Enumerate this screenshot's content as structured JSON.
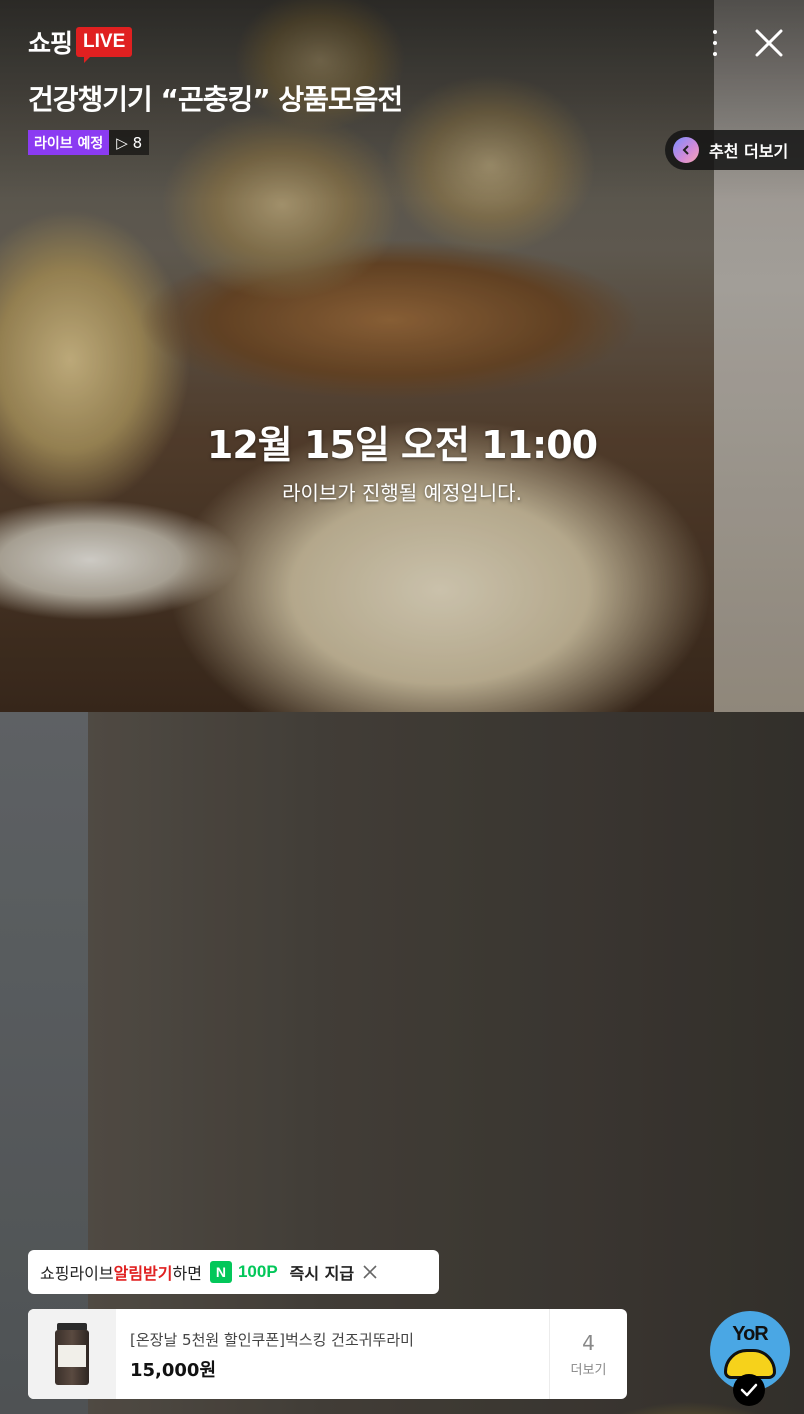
{
  "header": {
    "logo_text": "쇼핑",
    "logo_badge": "LIVE",
    "title": "건강챙기기 “곤충킹” 상품모음전",
    "status_badge": "라이브 예정",
    "view_count": "▷ 8"
  },
  "recommend": {
    "label": "추천 더보기"
  },
  "schedule": {
    "datetime": "12월 15일 오전 11:00",
    "message": "라이브가 진행될 예정입니다."
  },
  "notify": {
    "text_prefix": "쇼핑라이브 ",
    "text_highlight": "알림받기",
    "text_suffix": "하면",
    "pay_icon": "N",
    "points": "100P",
    "reward": "즉시 지급"
  },
  "product": {
    "name": "[온장날 5천원 할인쿠폰]벅스킹 건조귀뚜라미",
    "price": "15,000원",
    "count": "4",
    "more_label": "더보기"
  },
  "channel": {
    "avatar_text": "YoR"
  },
  "colors": {
    "live_red": "#e02020",
    "scheduled_purple": "#8b3bf2",
    "naver_green": "#03c75a"
  }
}
